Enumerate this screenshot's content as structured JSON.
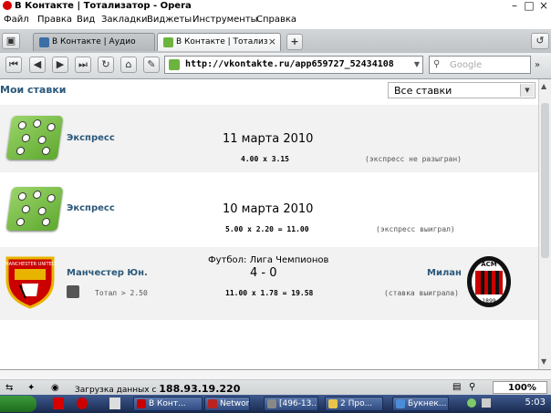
{
  "window": {
    "title": "В Контакте | Тотализатор - Opera"
  },
  "menu": [
    "Файл",
    "Правка",
    "Вид",
    "Закладки",
    "Виджеты",
    "Инструменты",
    "Справка"
  ],
  "tabs": [
    {
      "label": "В Контакте | Аудио",
      "active": false
    },
    {
      "label": "В Контакте | Тотализ...",
      "active": true
    }
  ],
  "nav": {
    "url": "http://vkontakte.ru/app659727_52434108",
    "search_placeholder": "Google"
  },
  "page": {
    "title": "Мои ставки",
    "filter_value": "Все ставки",
    "bets": [
      {
        "type": "Экспресс",
        "date": "11 марта 2010",
        "odds": "4.00 x 3.15",
        "status": "(экспресс не разыгран)"
      },
      {
        "type": "Экспресс",
        "date": "10 марта 2010",
        "odds": "5.00 x 2.20 = 11.00",
        "status": "(экспресс выиграл)"
      }
    ],
    "match": {
      "league": "Футбол: Лига Чемпионов",
      "home": "Манчестер Юн.",
      "away": "Милан",
      "score": "4 - 0",
      "total": "Тотал > 2.50",
      "odds": "11.00 x 1.78 = 19.58",
      "status": "(ставка выиграла)",
      "home_crest_text": "MANCHESTER UNITED",
      "away_crest_text": "ACM",
      "away_crest_year": "1899"
    }
  },
  "status": {
    "loading_text": "Загрузка данных с",
    "ip": "188.93.19.220",
    "zoom": "100%"
  },
  "taskbar": {
    "items": [
      "В Конт...",
      "Networ...",
      "[496-13...",
      "2 Про...",
      "Букнек..."
    ],
    "time": "5:03"
  },
  "colors": {
    "link": "#2b587a",
    "title_red": "#d90000"
  }
}
